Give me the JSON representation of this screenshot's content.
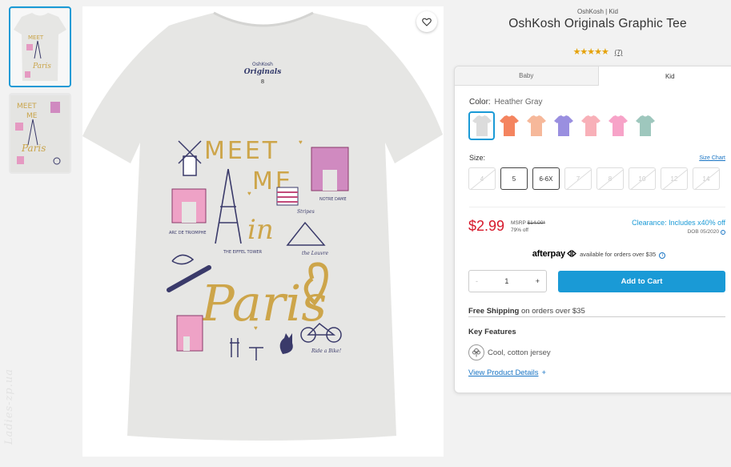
{
  "product": {
    "brand_line": "OshKosh | Kid",
    "title": "OshKosh Originals Graphic Tee",
    "rating_stars": "★★★★★",
    "rating_count": "(7)"
  },
  "image": {
    "shirt_color": "#e6e6e4",
    "print_text_meet": "MEET",
    "print_text_me": "ME",
    "print_text_in": "in",
    "print_text_paris": "Paris",
    "label_brand": "OshKosh",
    "label_line": "Originals",
    "label_size": "8",
    "caption_arc": "ARC DE TRIOMPHE",
    "caption_eiffel": "THE EIFFEL TOWER",
    "caption_notre": "NOTRE DAME",
    "caption_stripes": "Stripes",
    "caption_louvre": "the Louvre",
    "caption_bike": "Ride a Bike!"
  },
  "watermark": "Ladies-zp.ua",
  "tabs": [
    {
      "label": "Baby"
    },
    {
      "label": "Kid"
    }
  ],
  "color": {
    "label": "Color:",
    "value": "Heather Gray",
    "swatches": [
      {
        "name": "heather-gray",
        "color": "#dcdcdc",
        "selected": true
      },
      {
        "name": "orange",
        "color": "#f4845f"
      },
      {
        "name": "peach",
        "color": "#f6b89a"
      },
      {
        "name": "purple",
        "color": "#9a8fe0"
      },
      {
        "name": "pink",
        "color": "#f8b0b8"
      },
      {
        "name": "bright-pink",
        "color": "#f7a3c8"
      },
      {
        "name": "sage",
        "color": "#9ec7bd"
      }
    ]
  },
  "size": {
    "label": "Size:",
    "chart_link": "Size Chart",
    "options": [
      {
        "label": "4",
        "available": false
      },
      {
        "label": "5",
        "available": true
      },
      {
        "label": "6-6X",
        "available": true
      },
      {
        "label": "7",
        "available": false
      },
      {
        "label": "8",
        "available": false
      },
      {
        "label": "10",
        "available": false
      },
      {
        "label": "12",
        "available": false
      },
      {
        "label": "14",
        "available": false
      }
    ]
  },
  "price": {
    "sale": "$2.99",
    "msrp_label": "MSRP",
    "msrp_value": "$14.00*",
    "discount": "79% off",
    "clearance": "Clearance: Includes x40% off",
    "dob": "DOB 05/2020",
    "colors": {
      "sale": "#d6172a",
      "accent": "#1a9ad6"
    }
  },
  "afterpay": {
    "logo": "afterpay",
    "text": "available for orders over $35"
  },
  "quantity": {
    "minus": "-",
    "value": "1",
    "plus": "+"
  },
  "cart_button": "Add to Cart",
  "shipping": {
    "bold": "Free Shipping",
    "rest": "on orders over $35"
  },
  "features": {
    "title": "Key Features",
    "items": [
      {
        "icon": "cotton-icon",
        "text": "Cool, cotton jersey"
      }
    ]
  },
  "details_link": "View Product Details",
  "details_plus": "+"
}
